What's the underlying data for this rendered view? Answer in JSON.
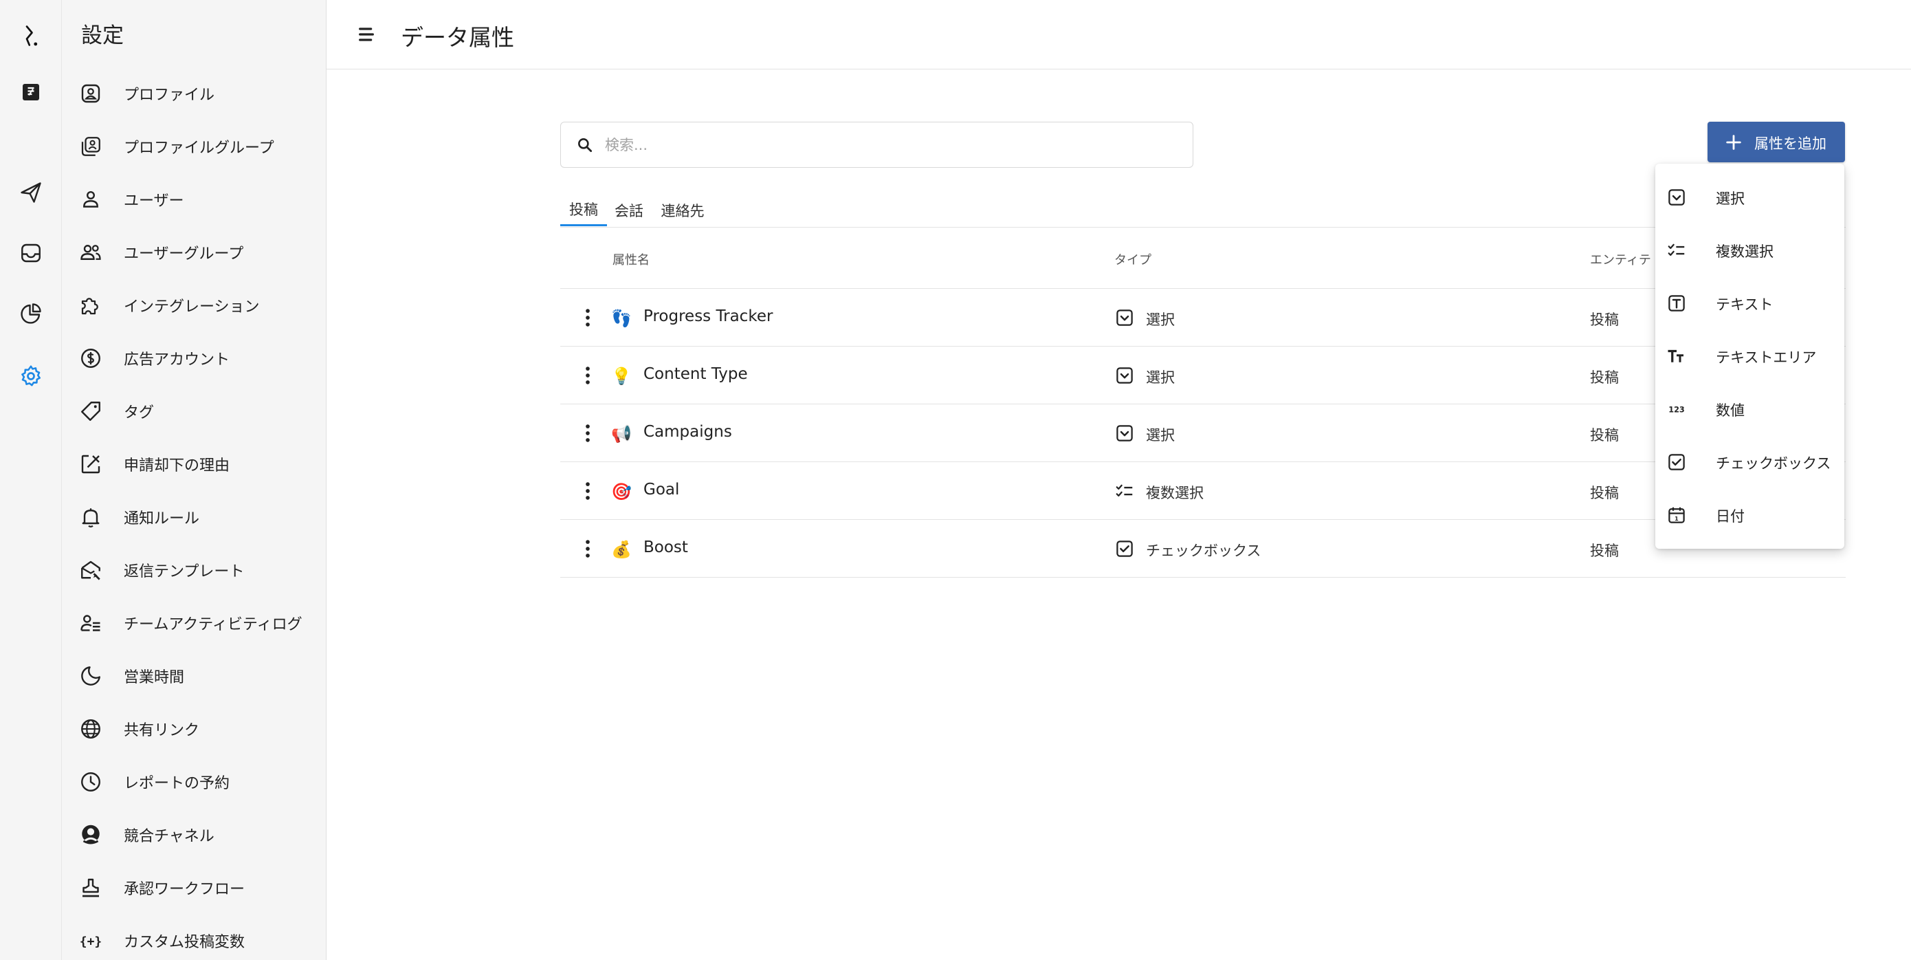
{
  "header": {
    "title": "データ属性"
  },
  "sidebar": {
    "title": "設定",
    "items": [
      {
        "label": "プロファイル",
        "icon": "profile-icon"
      },
      {
        "label": "プロファイルグループ",
        "icon": "profile-group-icon"
      },
      {
        "label": "ユーザー",
        "icon": "user-icon"
      },
      {
        "label": "ユーザーグループ",
        "icon": "user-group-icon"
      },
      {
        "label": "インテグレーション",
        "icon": "puzzle-icon"
      },
      {
        "label": "広告アカウント",
        "icon": "dollar-icon"
      },
      {
        "label": "タグ",
        "icon": "tag-icon"
      },
      {
        "label": "申請却下の理由",
        "icon": "reject-icon"
      },
      {
        "label": "通知ルール",
        "icon": "bell-icon"
      },
      {
        "label": "返信テンプレート",
        "icon": "reply-template-icon"
      },
      {
        "label": "チームアクティビティログ",
        "icon": "team-activity-icon"
      },
      {
        "label": "営業時間",
        "icon": "moon-icon"
      },
      {
        "label": "共有リンク",
        "icon": "globe-icon"
      },
      {
        "label": "レポートの予約",
        "icon": "clock-icon"
      },
      {
        "label": "競合チャネル",
        "icon": "competitor-icon"
      },
      {
        "label": "承認ワークフロー",
        "icon": "stamp-icon"
      },
      {
        "label": "カスタム投稿変数",
        "icon": "variable-icon"
      }
    ]
  },
  "rail": {
    "items": [
      "logo-icon",
      "publish-icon",
      "send-icon",
      "inbox-icon",
      "analytics-icon",
      "settings-icon"
    ],
    "active": "settings-icon",
    "active_color": "#1e88e5"
  },
  "search": {
    "placeholder": "検索..."
  },
  "tabs": [
    {
      "label": "投稿",
      "active": true
    },
    {
      "label": "会話",
      "active": false
    },
    {
      "label": "連絡先",
      "active": false
    }
  ],
  "table": {
    "columns": {
      "name": "属性名",
      "type": "タイプ",
      "entity": "エンティテ"
    },
    "rows": [
      {
        "emoji": "👣",
        "name": "Progress Tracker",
        "type": "選択",
        "type_icon": "select-icon",
        "entity": "投稿"
      },
      {
        "emoji": "💡",
        "name": "Content Type",
        "type": "選択",
        "type_icon": "select-icon",
        "entity": "投稿"
      },
      {
        "emoji": "📢",
        "name": "Campaigns",
        "type": "選択",
        "type_icon": "select-icon",
        "entity": "投稿"
      },
      {
        "emoji": "🎯",
        "name": "Goal",
        "type": "複数選択",
        "type_icon": "multi-select-icon",
        "entity": "投稿"
      },
      {
        "emoji": "💰",
        "name": "Boost",
        "type": "チェックボックス",
        "type_icon": "checkbox-icon",
        "entity": "投稿"
      }
    ]
  },
  "add_button": {
    "label": "属性を追加",
    "color": "#3b63a8"
  },
  "menu": {
    "items": [
      {
        "label": "選択",
        "icon": "select-icon"
      },
      {
        "label": "複数選択",
        "icon": "multi-select-icon"
      },
      {
        "label": "テキスト",
        "icon": "text-icon"
      },
      {
        "label": "テキストエリア",
        "icon": "text-area-icon"
      },
      {
        "label": "数値",
        "icon": "number-icon"
      },
      {
        "label": "チェックボックス",
        "icon": "checkbox-icon"
      },
      {
        "label": "日付",
        "icon": "calendar-icon"
      }
    ]
  }
}
